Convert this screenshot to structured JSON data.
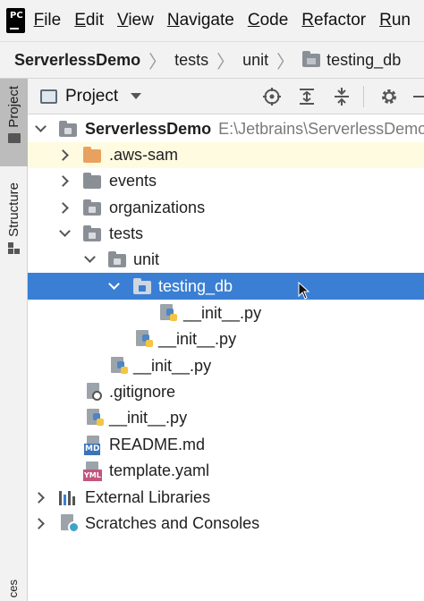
{
  "menu": {
    "items": [
      {
        "mnemonic": "F",
        "rest": "ile"
      },
      {
        "mnemonic": "E",
        "rest": "dit"
      },
      {
        "mnemonic": "V",
        "rest": "iew"
      },
      {
        "mnemonic": "N",
        "rest": "avigate"
      },
      {
        "mnemonic": "C",
        "rest": "ode"
      },
      {
        "mnemonic": "R",
        "rest": "efactor"
      },
      {
        "mnemonic": "R",
        "rest": "un"
      }
    ]
  },
  "breadcrumb": [
    "ServerlessDemo",
    "tests",
    "unit",
    "testing_db"
  ],
  "strip": {
    "project_label": "Project",
    "structure_label": "Structure",
    "bottom_label": "ces"
  },
  "tool_window": {
    "title": "Project"
  },
  "tree": {
    "root": {
      "name": "ServerlessDemo",
      "path": "E:\\Jetbrains\\ServerlessDemo"
    },
    "aws_sam": ".aws-sam",
    "events": "events",
    "organizations": "organizations",
    "tests": "tests",
    "unit": "unit",
    "testing_db": "testing_db",
    "init_testing_db": "__init__.py",
    "init_unit": "__init__.py",
    "init_tests": "__init__.py",
    "gitignore": ".gitignore",
    "init_root": "__init__.py",
    "readme": "README.md",
    "template": "template.yaml",
    "external_libraries": "External Libraries",
    "scratches": "Scratches and Consoles"
  },
  "icons": {
    "md_badge": "MD",
    "yml_badge": "YML"
  },
  "colors": {
    "selection": "#3a7fd4",
    "highlight_row": "#fffbe1",
    "folder_gray": "#8a8f96",
    "folder_orange": "#e9a15f"
  }
}
